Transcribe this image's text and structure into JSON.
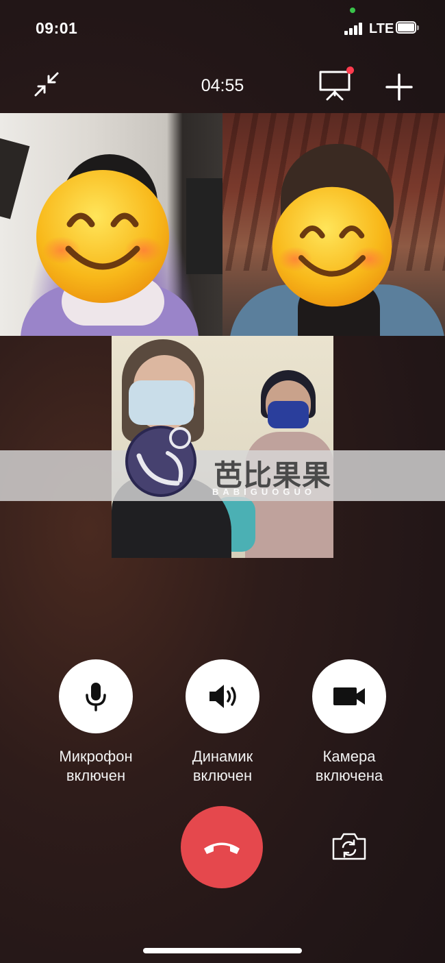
{
  "status_bar": {
    "time": "09:01",
    "carrier": "LTE",
    "signal_bars": 4,
    "battery_level": 0.9,
    "camera_in_use_indicator_color": "#3ac34a"
  },
  "toolbar": {
    "timer": "04:55",
    "minimize_icon": "minimize-arrows-icon",
    "screen_share_icon": "presentation-screen-icon",
    "screen_share_badge_color": "#ff3b4e",
    "add_icon": "plus-icon"
  },
  "participants": [
    {
      "tile": "remote-1",
      "face_covered_by_emoji": "smiling-face-emoji"
    },
    {
      "tile": "remote-2",
      "face_covered_by_emoji": "smiling-face-emoji"
    },
    {
      "tile": "self-view"
    }
  ],
  "watermark": {
    "text": "芭比果果",
    "subtext": "BABIGUOGUO"
  },
  "controls": {
    "microphone": {
      "label": "Микрофон включен",
      "icon": "microphone-icon"
    },
    "speaker": {
      "label": "Динамик включен",
      "icon": "speaker-icon"
    },
    "camera": {
      "label": "Камера включена",
      "icon": "video-camera-icon"
    },
    "hangup": {
      "icon": "phone-hangup-icon",
      "color": "#e5484d"
    },
    "flip_camera": {
      "icon": "flip-camera-icon"
    }
  }
}
